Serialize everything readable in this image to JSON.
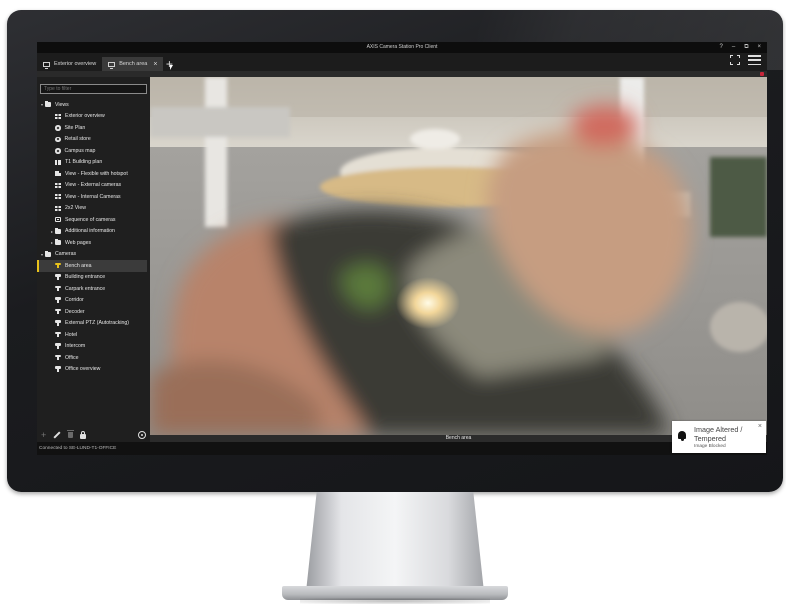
{
  "app": {
    "title": "AXIS Camera Station Pro Client",
    "window_controls": [
      "?",
      "–",
      "⧉",
      "×"
    ]
  },
  "tabs": [
    {
      "label": "Exterior overview",
      "active": false
    },
    {
      "label": "Bench area",
      "active": true,
      "close": "×"
    }
  ],
  "add_tab": "+",
  "sidebar": {
    "filter_placeholder": "Type to filter",
    "tree": [
      {
        "label": "Views",
        "icon": "folder-icon",
        "caret": "▾",
        "level": 0
      },
      {
        "label": "Exterior overview",
        "icon": "grid-view-icon",
        "level": 1
      },
      {
        "label": "Site Plan",
        "icon": "map-icon",
        "level": 1
      },
      {
        "label": "Retail store",
        "icon": "map-icon",
        "level": 1
      },
      {
        "label": "Campus map",
        "icon": "map-icon",
        "level": 1
      },
      {
        "label": "T1 Building plan",
        "icon": "floor-plan-icon",
        "level": 1
      },
      {
        "label": "View - Flexible with hotspot",
        "icon": "view-icon",
        "level": 1
      },
      {
        "label": "View - External cameras",
        "icon": "grid-view-icon",
        "level": 1
      },
      {
        "label": "View - Internal Cameras",
        "icon": "grid-view-icon",
        "level": 1
      },
      {
        "label": "2x2 View",
        "icon": "grid-view-icon",
        "level": 1
      },
      {
        "label": "Sequence of cameras",
        "icon": "sequence-icon",
        "level": 1
      },
      {
        "label": "Additional information",
        "icon": "folder-icon",
        "caret": "▸",
        "level": 1
      },
      {
        "label": "Web pages",
        "icon": "folder-icon",
        "caret": "▸",
        "level": 1
      },
      {
        "label": "Cameras",
        "icon": "folder-icon",
        "caret": "▾",
        "level": 0
      },
      {
        "label": "Bench area",
        "icon": "camera-icon",
        "level": 1,
        "selected": true
      },
      {
        "label": "Building entrance",
        "icon": "camera-icon",
        "level": 1
      },
      {
        "label": "Carpark entrance",
        "icon": "camera-icon",
        "level": 1
      },
      {
        "label": "Corridor",
        "icon": "camera-icon",
        "level": 1
      },
      {
        "label": "Decoder",
        "icon": "camera-icon",
        "level": 1
      },
      {
        "label": "External PTZ (Autotracking)",
        "icon": "camera-icon",
        "level": 1
      },
      {
        "label": "Hotel",
        "icon": "camera-icon",
        "level": 1
      },
      {
        "label": "Intercom",
        "icon": "camera-icon",
        "level": 1
      },
      {
        "label": "Office",
        "icon": "camera-icon",
        "level": 1
      },
      {
        "label": "Office overview",
        "icon": "camera-icon",
        "level": 1
      }
    ],
    "bottom_add": "+"
  },
  "video": {
    "label": "Bench area"
  },
  "status": {
    "text": "Connected to SE-LUND-T1-OFFICE"
  },
  "notification": {
    "title": "Image Altered / Tempered",
    "subtitle": "Image Blocked",
    "close": "×"
  },
  "colors": {
    "accent": "#e8c21b",
    "recording": "#c8253a"
  }
}
